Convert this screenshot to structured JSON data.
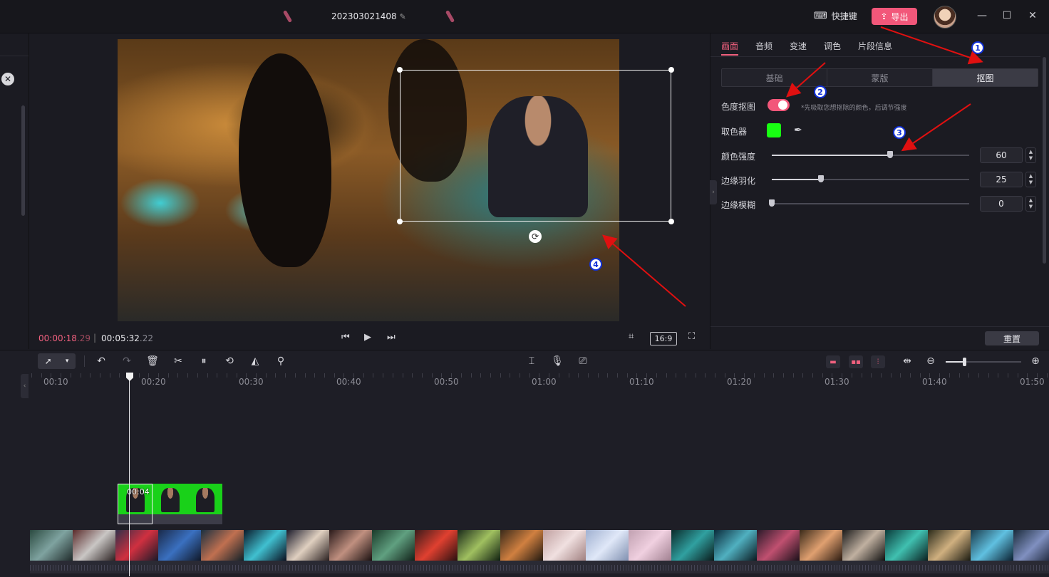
{
  "window": {
    "title": "202303021408",
    "shortcut_label": "快捷键",
    "export_label": "导出",
    "colors": {
      "accent": "#f2577a",
      "background": "#1b1b22"
    }
  },
  "player": {
    "time_current_main": "00:00:18",
    "time_current_frac": ".29",
    "time_total_main": "00:05:32",
    "time_total_frac": ".22",
    "aspect_ratio": "16:9"
  },
  "inspector": {
    "tabs": [
      {
        "label": "画面",
        "active": true
      },
      {
        "label": "音频",
        "active": false
      },
      {
        "label": "变速",
        "active": false
      },
      {
        "label": "调色",
        "active": false
      },
      {
        "label": "片段信息",
        "active": false
      }
    ],
    "segments": [
      {
        "label": "基础",
        "active": false
      },
      {
        "label": "蒙版",
        "active": false
      },
      {
        "label": "抠图",
        "active": true
      }
    ],
    "chroma_key": {
      "label": "色度抠图",
      "enabled": true,
      "hint": "*先吸取您想抠除的颜色，后调节强度"
    },
    "color_picker": {
      "label": "取色器",
      "color": "#18ff12"
    },
    "sliders": [
      {
        "label": "颜色强度",
        "value": "60",
        "level": 0.6
      },
      {
        "label": "边缘羽化",
        "value": "25",
        "level": 0.25
      },
      {
        "label": "边缘模糊",
        "value": "0",
        "level": 0
      }
    ],
    "reset_label": "重置"
  },
  "timeline": {
    "ruler_labels": [
      "00:10",
      "00:20",
      "00:30",
      "00:40",
      "00:50",
      "01:00",
      "01:10",
      "01:20",
      "01:30",
      "01:40",
      "01:50"
    ],
    "clip_duration": "00:04"
  },
  "annotations": {
    "badges": [
      "1",
      "2",
      "3",
      "4"
    ],
    "arrow_color": "#e01010"
  }
}
